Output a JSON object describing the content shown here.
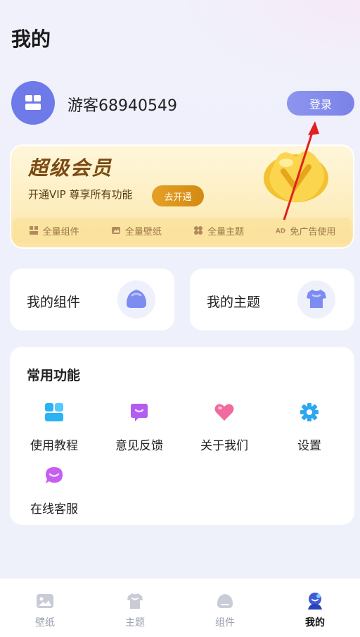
{
  "page": {
    "title": "我的"
  },
  "profile": {
    "username": "游客68940549",
    "login_label": "登录"
  },
  "vip": {
    "title": "超级会员",
    "subtitle": "开通VIP 尊享所有功能",
    "open_label": "去开通",
    "features": [
      {
        "icon": "widget-icon",
        "label": "全量组件"
      },
      {
        "icon": "wallpaper-icon",
        "label": "全量壁纸"
      },
      {
        "icon": "theme-icon",
        "label": "全量主题"
      },
      {
        "icon": "ad-icon",
        "label": "免广告使用"
      }
    ]
  },
  "quick": {
    "widgets_label": "我的组件",
    "themes_label": "我的主题"
  },
  "functions": {
    "title": "常用功能",
    "items": [
      {
        "icon": "tutorial-icon",
        "label": "使用教程"
      },
      {
        "icon": "feedback-icon",
        "label": "意见反馈"
      },
      {
        "icon": "heart-icon",
        "label": "关于我们"
      },
      {
        "icon": "settings-gear-icon",
        "label": "设置"
      },
      {
        "icon": "customer-service-icon",
        "label": "在线客服"
      }
    ]
  },
  "nav": {
    "items": [
      {
        "icon": "wallpaper-icon",
        "label": "壁纸"
      },
      {
        "icon": "tshirt-icon",
        "label": "主题"
      },
      {
        "icon": "widget-icon",
        "label": "组件"
      },
      {
        "icon": "profile-icon",
        "label": "我的"
      }
    ],
    "active_index": 3
  },
  "colors": {
    "accent": "#7b82e8",
    "vip_gold": "#d48a12",
    "annotation_arrow": "#e02020"
  }
}
